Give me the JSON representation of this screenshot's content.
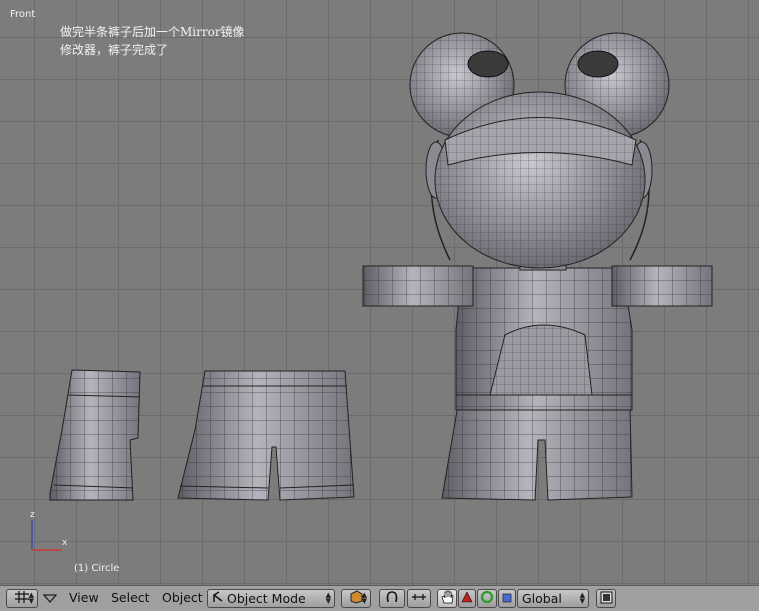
{
  "viewport": {
    "view_label": "Front",
    "annotation_line1": "做完半条裤子后加一个Mirror镜像",
    "annotation_line2": "修改器，裤子完成了",
    "status": "(1) Circle",
    "axes": {
      "z_label": "z",
      "x_label": "x"
    }
  },
  "header": {
    "editor_type_icon": "grid-icon",
    "menus": {
      "view": "View",
      "select": "Select",
      "object": "Object"
    },
    "mode_select": {
      "icon": "mode-icon",
      "value": "Object Mode"
    },
    "draw_type_icon": "cube-draw-icon",
    "pivot_icon": "pivot-icon",
    "manipulator_icons": [
      "hand-icon",
      "translate-icon",
      "rotate-icon",
      "scale-icon"
    ],
    "orientation_select": {
      "value": "Global"
    },
    "render_icon": "render-icon"
  }
}
